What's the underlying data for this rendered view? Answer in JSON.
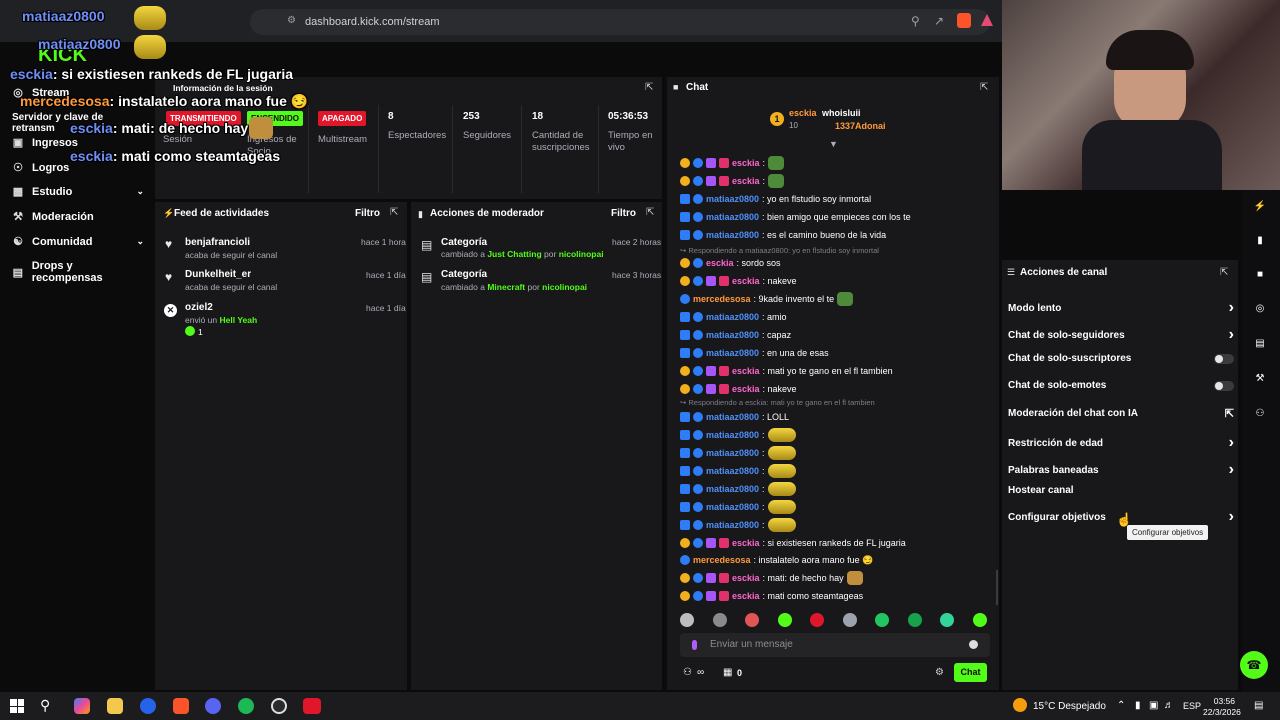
{
  "browser": {
    "url": "dashboard.kick.com/stream"
  },
  "sidebar": {
    "items": [
      {
        "label": "Stream"
      },
      {
        "label": "Servidor y clave de retransm"
      },
      {
        "label": "Ingresos"
      },
      {
        "label": "Logros"
      },
      {
        "label": "Estudio"
      },
      {
        "label": "Moderación"
      },
      {
        "label": "Comunidad"
      },
      {
        "label": "Drops y recompensas"
      }
    ]
  },
  "session": {
    "title": "Información de la sesión",
    "status_badge": "TRANSMITIENDO",
    "status_label": "Sesión",
    "income_badge": "ENCENDIDO",
    "income_label": "Ingresos de Socio",
    "multistream_badge": "APAGADO",
    "multistream_label": "Multistream",
    "stats": [
      {
        "value": "8",
        "label": "Espectadores"
      },
      {
        "value": "253",
        "label": "Seguidores"
      },
      {
        "value": "18",
        "label": "Cantidad de suscripciones"
      },
      {
        "value": "05:36:53",
        "label": "Tiempo en vivo"
      }
    ]
  },
  "activity_feed": {
    "title": "Feed de actividades",
    "filter_label": "Filtro",
    "items": [
      {
        "name": "benjafrancioli",
        "sub": "acaba de seguir el canal",
        "time": "hace 1 hora"
      },
      {
        "name": "Dunkelheit_er",
        "sub": "acaba de seguir el canal",
        "time": "hace 1 día"
      },
      {
        "name": "oziel2",
        "sub_prefix": "envió un",
        "sub_highlight": "Hell Yeah",
        "count": "1",
        "time": "hace 1 día"
      }
    ]
  },
  "mod_actions": {
    "title": "Acciones de moderador",
    "filter_label": "Filtro",
    "items": [
      {
        "name": "Categoría",
        "prefix": "cambiado a",
        "category": "Just Chatting",
        "by": "por",
        "mod": "nicolinopai",
        "time": "hace 2 horas"
      },
      {
        "name": "Categoría",
        "prefix": "cambiado a",
        "category": "Minecraft",
        "by": "por",
        "mod": "nicolinopai",
        "time": "hace 3 horas"
      }
    ]
  },
  "chat": {
    "title": "Chat",
    "pinned": {
      "user1": "esckia",
      "count1": "10",
      "user2": "whoisluii",
      "user3": "1337Adonai"
    },
    "messages": [
      {
        "user": "esckia",
        "style": "orange-badge",
        "text": "",
        "emote": "pepe"
      },
      {
        "user": "esckia",
        "style": "orange-badge",
        "text": "",
        "emote": "pepe"
      },
      {
        "user": "matiaaz0800",
        "style": "blue",
        "text": "yo en flstudio soy inmortal"
      },
      {
        "user": "matiaaz0800",
        "style": "blue",
        "text": "bien amigo que empieces con los te"
      },
      {
        "user": "matiaaz0800",
        "style": "blue",
        "text": "es el camino bueno de la vida"
      },
      {
        "reply": "Respondiendo a matiaaz0800: yo en flstudio soy inmortal"
      },
      {
        "user": "esckia",
        "style": "pink",
        "text": "sordo sos"
      },
      {
        "user": "esckia",
        "style": "orange-badge",
        "text": "nakeve"
      },
      {
        "user": "mercedesosa",
        "style": "orange",
        "text": "9kade invento el te",
        "emote": "pepe"
      },
      {
        "user": "matiaaz0800",
        "style": "blue",
        "text": "amio"
      },
      {
        "user": "matiaaz0800",
        "style": "blue",
        "text": "capaz"
      },
      {
        "user": "matiaaz0800",
        "style": "blue",
        "text": "en una de esas"
      },
      {
        "user": "esckia",
        "style": "orange-badge",
        "text": "mati yo te gano en el fl tambien"
      },
      {
        "user": "esckia",
        "style": "orange-badge",
        "text": "nakeve"
      },
      {
        "reply": "Respondiendo a esckia: mati yo te gano en el fl tambien"
      },
      {
        "user": "matiaaz0800",
        "style": "blue",
        "text": "LOLL"
      },
      {
        "user": "matiaaz0800",
        "style": "blue",
        "text": "",
        "emote": "minion"
      },
      {
        "user": "matiaaz0800",
        "style": "blue",
        "text": "",
        "emote": "minion"
      },
      {
        "user": "matiaaz0800",
        "style": "blue",
        "text": "",
        "emote": "minion"
      },
      {
        "user": "matiaaz0800",
        "style": "blue",
        "text": "",
        "emote": "minion"
      },
      {
        "user": "matiaaz0800",
        "style": "blue",
        "text": "",
        "emote": "minion"
      },
      {
        "user": "matiaaz0800",
        "style": "blue",
        "text": "",
        "emote": "minion"
      },
      {
        "user": "esckia",
        "style": "orange-badge",
        "text": "si existiesen rankeds de FL jugaria"
      },
      {
        "user": "mercedesosa",
        "style": "orange",
        "text": "instalatelo aora mano fue 😏"
      },
      {
        "user": "esckia",
        "style": "orange-badge",
        "text": "mati: de hecho hay",
        "emote": "cat"
      },
      {
        "user": "esckia",
        "style": "orange-badge",
        "text": "mati como steamtageas"
      }
    ],
    "input_placeholder": "Enviar un mensaje",
    "infinity_label": "∞",
    "points": "0",
    "send_label": "Chat"
  },
  "channel_actions": {
    "title": "Acciones de canal",
    "items": [
      {
        "label": "Modo lento",
        "control": "chevron"
      },
      {
        "label": "Chat de solo-seguidores",
        "control": "chevron"
      },
      {
        "label": "Chat de solo-suscriptores",
        "control": "toggle"
      },
      {
        "label": "Chat de solo-emotes",
        "control": "toggle"
      },
      {
        "label": "Moderación del chat con IA",
        "control": "external"
      },
      {
        "label": "Restricción de edad",
        "control": "chevron"
      },
      {
        "label": "Palabras baneadas",
        "control": "chevron"
      },
      {
        "label": "Hostear canal",
        "control": "none"
      },
      {
        "label": "Configurar objetivos",
        "control": "chevron"
      }
    ],
    "tooltip": "Configurar objetivos"
  },
  "overlay": {
    "lines": [
      {
        "user": "matiaaz0800",
        "text": ""
      },
      {
        "user": "matiaaz0800",
        "text": ""
      },
      {
        "user": "esckia",
        "text": "si existiesen rankeds de FL jugaria"
      },
      {
        "user": "mercedesosa",
        "text": "instalatelo aora mano fue 😏"
      },
      {
        "user": "esckia",
        "text": "mati: de hecho hay"
      },
      {
        "user": "esckia",
        "text": "mati como steamtageas"
      }
    ],
    "logo": "KICK"
  },
  "taskbar": {
    "weather": "15°C Despejado",
    "lang": "ESP",
    "time": "03:56",
    "date": "22/3/2026"
  },
  "colors": {
    "accent": "#53fc18",
    "panel": "#18181b",
    "bg": "#0b0b0c",
    "live": "#e0172b"
  }
}
